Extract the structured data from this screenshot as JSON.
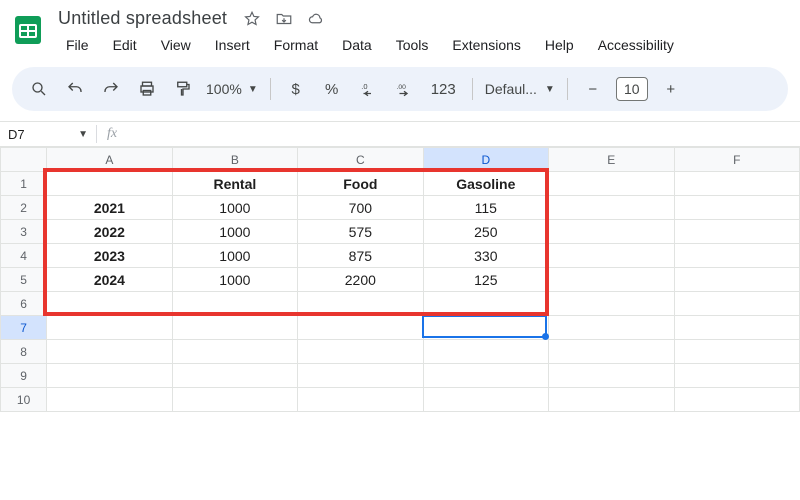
{
  "doc": {
    "title": "Untitled spreadsheet"
  },
  "menu": {
    "file": "File",
    "edit": "Edit",
    "view": "View",
    "insert": "Insert",
    "format": "Format",
    "data": "Data",
    "tools": "Tools",
    "extensions": "Extensions",
    "help": "Help",
    "accessibility": "Accessibility"
  },
  "toolbar": {
    "zoom": "100%",
    "currency": "$",
    "percent": "%",
    "dec_dec": ".0",
    "inc_dec": ".00",
    "num_format": "123",
    "font_name": "Defaul...",
    "font_size": "10",
    "minus": "−",
    "plus": "+"
  },
  "namebox": {
    "ref": "D7"
  },
  "fx": {
    "label": "fx"
  },
  "columns": [
    "A",
    "B",
    "C",
    "D",
    "E",
    "F"
  ],
  "rowcount": 10,
  "selected": {
    "col": "D",
    "row": 7
  },
  "chart_data": {
    "type": "table",
    "title": "",
    "categories": [
      "2021",
      "2022",
      "2023",
      "2024"
    ],
    "series": [
      {
        "name": "Rental",
        "values": [
          1000,
          1000,
          1000,
          1000
        ]
      },
      {
        "name": "Food",
        "values": [
          700,
          575,
          875,
          2200
        ]
      },
      {
        "name": "Gasoline",
        "values": [
          115,
          250,
          330,
          125
        ]
      }
    ]
  },
  "cells": {
    "B1": "Rental",
    "C1": "Food",
    "D1": "Gasoline",
    "A2": "2021",
    "B2": "1000",
    "C2": "700",
    "D2": "115",
    "A3": "2022",
    "B3": "1000",
    "C3": "575",
    "D3": "250",
    "A4": "2023",
    "B4": "1000",
    "C4": "875",
    "D4": "330",
    "A5": "2024",
    "B5": "1000",
    "C5": "2200",
    "D5": "125"
  },
  "bold_cells": [
    "B1",
    "C1",
    "D1",
    "A2",
    "A3",
    "A4",
    "A5"
  ]
}
